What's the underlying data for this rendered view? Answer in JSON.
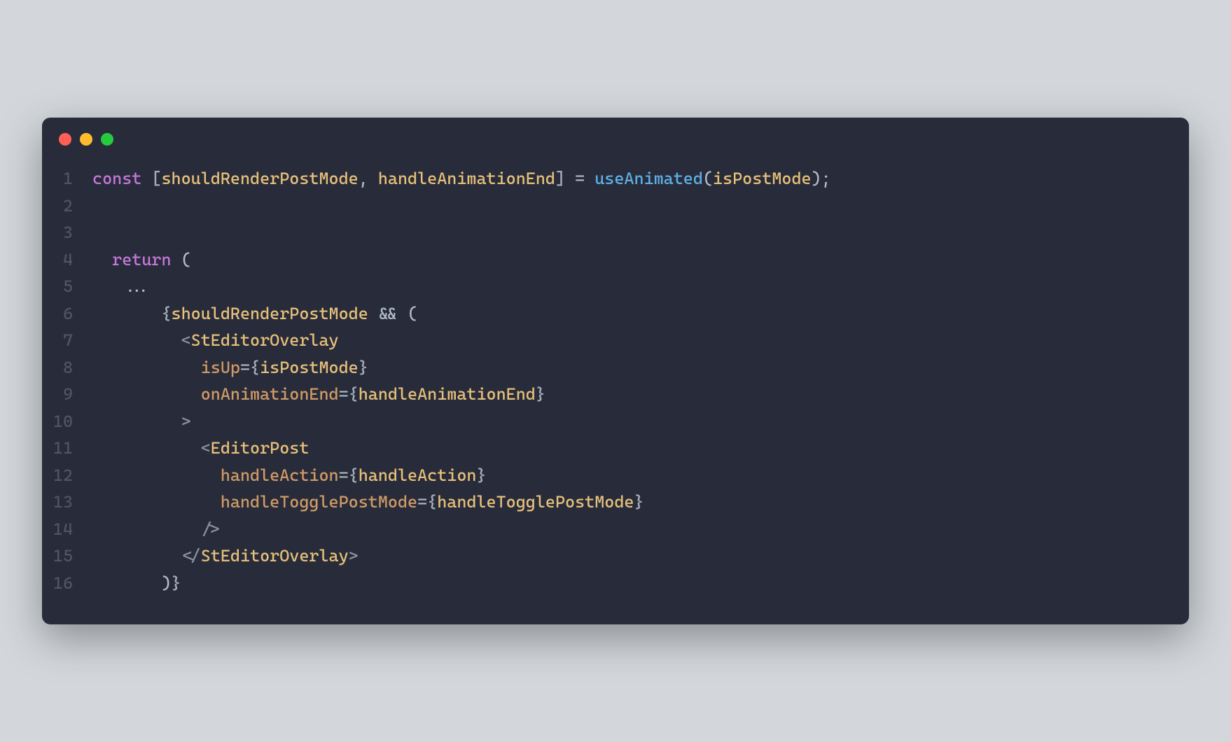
{
  "lines": {
    "l1_num": "1",
    "l2_num": "2",
    "l3_num": "3",
    "l4_num": "4",
    "l5_num": "5",
    "l6_num": "6",
    "l7_num": "7",
    "l8_num": "8",
    "l9_num": "9",
    "l10_num": "10",
    "l11_num": "11",
    "l12_num": "12",
    "l13_num": "13",
    "l14_num": "14",
    "l15_num": "15",
    "l16_num": "16"
  },
  "tokens": {
    "const": "const",
    "sp": " ",
    "lbracket": "[",
    "shouldRenderPostMode": "shouldRenderPostMode",
    "comma_sp": ", ",
    "handleAnimationEnd": "handleAnimationEnd",
    "rbracket": "]",
    "eq": " = ",
    "useAnimated": "useAnimated",
    "lparen": "(",
    "isPostMode": "isPostMode",
    "rparen": ")",
    "semi": ";",
    "return": "return",
    "dots": "...",
    "lbrace": "{",
    "rbrace": "}",
    "and": " && ",
    "lt": "<",
    "gt": ">",
    "slash": "/",
    "StEditorOverlay": "StEditorOverlay",
    "isUp": "isUp",
    "eq_only": "=",
    "onAnimationEnd": "onAnimationEnd",
    "EditorPost": "EditorPost",
    "handleAction_attr": "handleAction",
    "handleAction_val": "handleAction",
    "handleTogglePostMode_attr": "handleTogglePostMode",
    "handleTogglePostMode_val": "handleTogglePostMode",
    "indent2": "  ",
    "indent4": "   ",
    "indent8": "       ",
    "indent10": "         ",
    "indent12": "           ",
    "indent14": "             "
  }
}
